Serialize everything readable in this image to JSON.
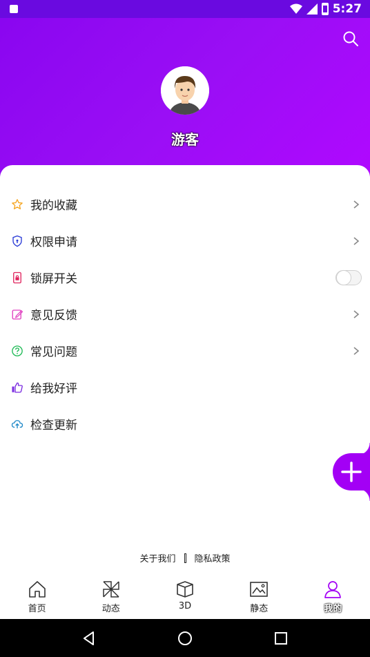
{
  "status_bar": {
    "time": "5:27"
  },
  "header": {
    "username": "游客"
  },
  "menu": [
    {
      "label": "我的收藏",
      "icon": "star-icon",
      "icon_color": "#f5a623",
      "control": "chevron"
    },
    {
      "label": "权限申请",
      "icon": "shield-icon",
      "icon_color": "#2a3bd6",
      "control": "chevron"
    },
    {
      "label": "锁屏开关",
      "icon": "lock-screen-icon",
      "icon_color": "#e0245e",
      "control": "toggle",
      "toggle_on": false
    },
    {
      "label": "意见反馈",
      "icon": "edit-feedback-icon",
      "icon_color": "#e040c0",
      "control": "chevron"
    },
    {
      "label": "常见问题",
      "icon": "question-icon",
      "icon_color": "#1db954",
      "control": "chevron"
    },
    {
      "label": "给我好评",
      "icon": "thumbs-up-icon",
      "icon_color": "#7a2be0",
      "control": "none"
    },
    {
      "label": "检查更新",
      "icon": "cloud-upload-icon",
      "icon_color": "#1e88c8",
      "control": "none"
    }
  ],
  "footer_links": {
    "about": "关于我们",
    "privacy": "隐私政策"
  },
  "tabs": [
    {
      "label": "首页",
      "icon": "home-icon"
    },
    {
      "label": "动态",
      "icon": "pinwheel-icon"
    },
    {
      "label": "3D",
      "icon": "cube-icon"
    },
    {
      "label": "静态",
      "icon": "image-icon"
    },
    {
      "label": "我的",
      "icon": "user-icon",
      "active": true
    }
  ],
  "colors": {
    "accent": "#a300f5",
    "header_start": "#8a06f0",
    "header_end": "#b008ff"
  }
}
